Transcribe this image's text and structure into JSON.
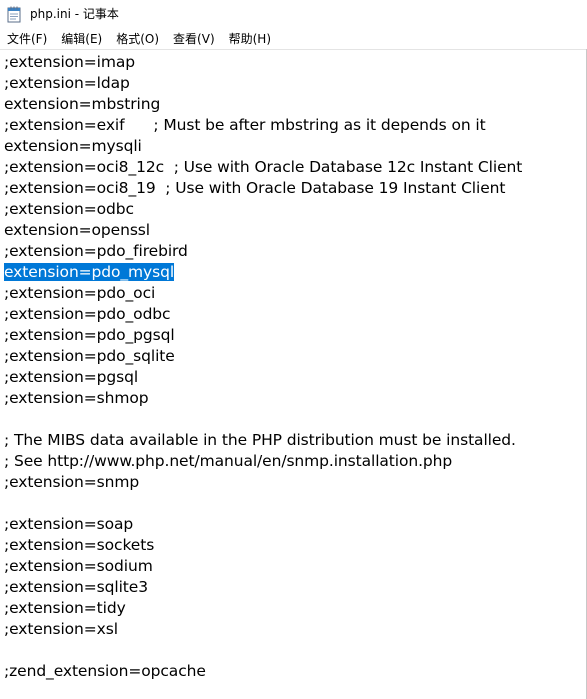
{
  "window": {
    "title": "php.ini - 记事本"
  },
  "menu": [
    {
      "label": "文件(F)"
    },
    {
      "label": "编辑(E)"
    },
    {
      "label": "格式(O)"
    },
    {
      "label": "查看(V)"
    },
    {
      "label": "帮助(H)"
    }
  ],
  "editor": {
    "selected_line_index": 10,
    "lines": [
      ";extension=imap",
      ";extension=ldap",
      "extension=mbstring",
      ";extension=exif      ; Must be after mbstring as it depends on it",
      "extension=mysqli",
      ";extension=oci8_12c  ; Use with Oracle Database 12c Instant Client",
      ";extension=oci8_19  ; Use with Oracle Database 19 Instant Client",
      ";extension=odbc",
      "extension=openssl",
      ";extension=pdo_firebird",
      "extension=pdo_mysql",
      ";extension=pdo_oci",
      ";extension=pdo_odbc",
      ";extension=pdo_pgsql",
      ";extension=pdo_sqlite",
      ";extension=pgsql",
      ";extension=shmop",
      "",
      "; The MIBS data available in the PHP distribution must be installed.",
      "; See http://www.php.net/manual/en/snmp.installation.php",
      ";extension=snmp",
      "",
      ";extension=soap",
      ";extension=sockets",
      ";extension=sodium",
      ";extension=sqlite3",
      ";extension=tidy",
      ";extension=xsl",
      "",
      ";zend_extension=opcache"
    ]
  },
  "colors": {
    "selection_bg": "#0078d7",
    "selection_fg": "#ffffff",
    "text": "#000000",
    "background": "#ffffff"
  }
}
